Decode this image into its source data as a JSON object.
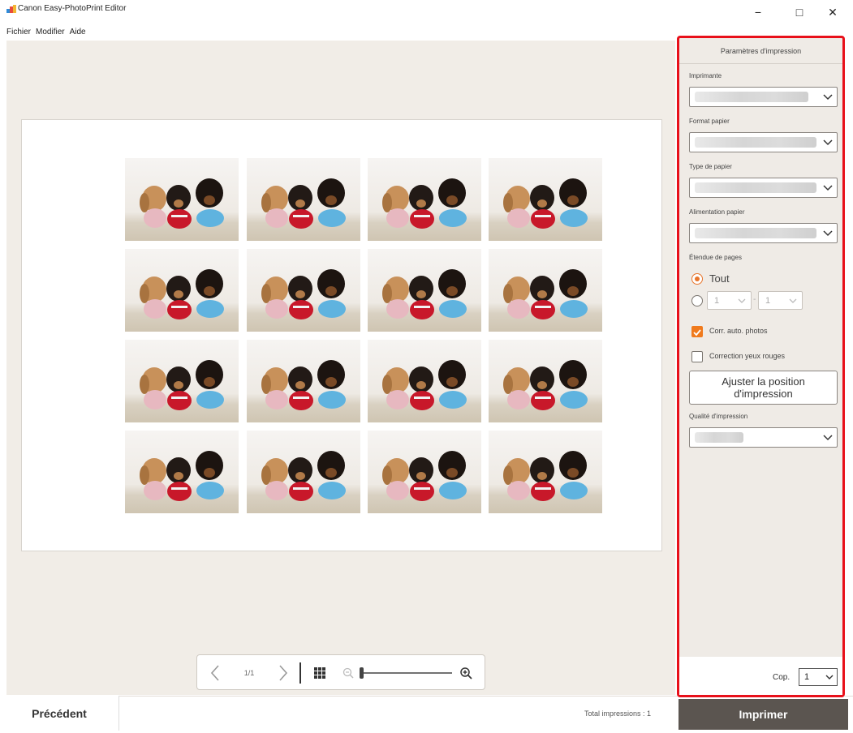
{
  "window": {
    "title": "Canon Easy-PhotoPrint Editor",
    "minimize": "−",
    "maximize": "□",
    "close": "✕"
  },
  "menu": {
    "items": [
      "Fichier",
      "Modifier",
      "Aide"
    ]
  },
  "preview": {
    "photo_count": 16,
    "page_indicator": "1/1"
  },
  "settings": {
    "header": "Paramètres d'impression",
    "printer_label": "Imprimante",
    "paper_size_label": "Format papier",
    "paper_type_label": "Type de papier",
    "paper_source_label": "Alimentation papier",
    "page_range_label": "Étendue de pages",
    "range_all_label": "Tout",
    "range_from": "1",
    "range_separator": "-",
    "range_to": "1",
    "auto_correct_label": "Corr. auto. photos",
    "auto_correct_checked": true,
    "red_eye_label": "Correction yeux rouges",
    "red_eye_checked": false,
    "adjust_position_line1": "Ajuster la position",
    "adjust_position_line2": "d'impression",
    "quality_label": "Qualité d'impression",
    "copies_label": "Cop.",
    "copies_value": "1"
  },
  "footer": {
    "previous_label": "Précédent",
    "total_label": "Total impressions : 1",
    "print_label": "Imprimer"
  },
  "colors": {
    "accent_orange": "#f07a1c",
    "highlight_red": "#e8101a",
    "print_button": "#5b5550",
    "workspace_bg": "#f1ede7"
  }
}
